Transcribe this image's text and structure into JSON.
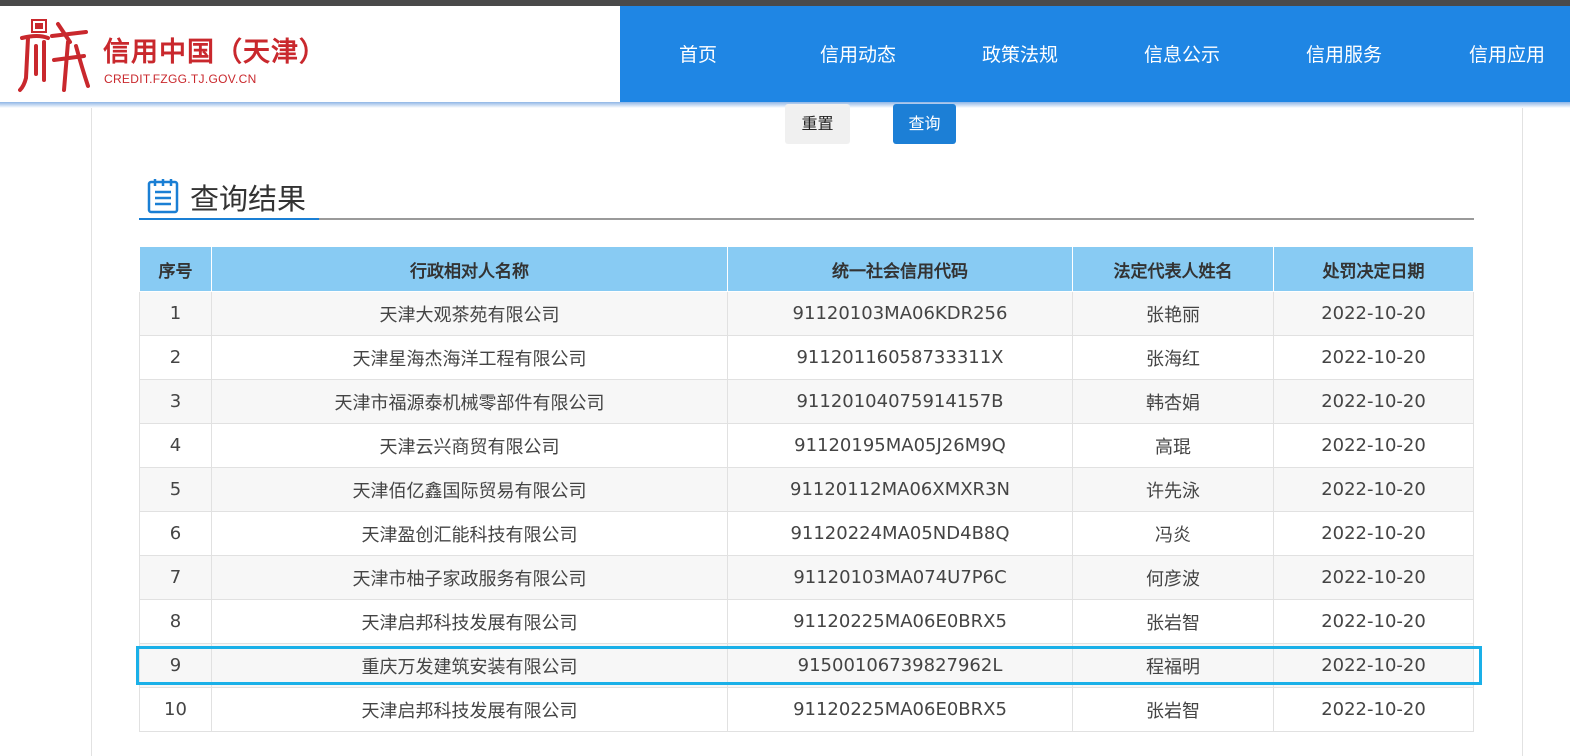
{
  "header": {
    "logo_title": "信用中国（天津）",
    "logo_subtitle": "CREDIT.FZGG.TJ.GOV.CN",
    "nav": [
      "首页",
      "信用动态",
      "政策法规",
      "信息公示",
      "信用服务",
      "信用应用"
    ]
  },
  "form": {
    "reset_label": "重置",
    "query_label": "查询"
  },
  "results": {
    "title": "查询结果",
    "columns": [
      "序号",
      "行政相对人名称",
      "统一社会信用代码",
      "法定代表人姓名",
      "处罚决定日期"
    ],
    "rows": [
      [
        "1",
        "天津大观茶苑有限公司",
        "91120103MA06KDR256",
        "张艳丽",
        "2022-10-20"
      ],
      [
        "2",
        "天津星海杰海洋工程有限公司",
        "91120116058733311X",
        "张海红",
        "2022-10-20"
      ],
      [
        "3",
        "天津市福源泰机械零部件有限公司",
        "91120104075914157B",
        "韩杏娟",
        "2022-10-20"
      ],
      [
        "4",
        "天津云兴商贸有限公司",
        "91120195MA05J26M9Q",
        "高琨",
        "2022-10-20"
      ],
      [
        "5",
        "天津佰亿鑫国际贸易有限公司",
        "91120112MA06XMXR3N",
        "许先泳",
        "2022-10-20"
      ],
      [
        "6",
        "天津盈创汇能科技有限公司",
        "91120224MA05ND4B8Q",
        "冯炎",
        "2022-10-20"
      ],
      [
        "7",
        "天津市柚子家政服务有限公司",
        "91120103MA074U7P6C",
        "何彦波",
        "2022-10-20"
      ],
      [
        "8",
        "天津启邦科技发展有限公司",
        "91120225MA06E0BRX5",
        "张岩智",
        "2022-10-20"
      ],
      [
        "9",
        "重庆万发建筑安装有限公司",
        "91500106739827962L",
        "程福明",
        "2022-10-20"
      ],
      [
        "10",
        "天津启邦科技发展有限公司",
        "91120225MA06E0BRX5",
        "张岩智",
        "2022-10-20"
      ]
    ]
  },
  "colors": {
    "nav_bg": "#1f86e4",
    "brand_red": "#c9282d",
    "table_header_bg": "#88cbf3",
    "highlight_border": "#1ab0e8"
  }
}
